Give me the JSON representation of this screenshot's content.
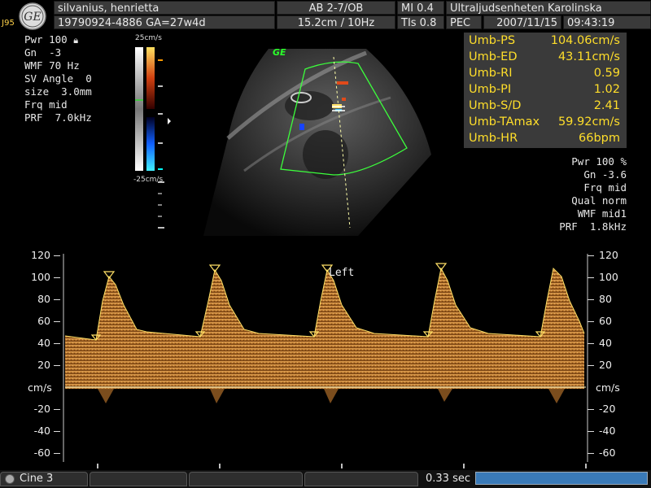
{
  "header": {
    "patient_name": "silvanius, henrietta",
    "patient_id_ga": "19790924-4886  GA=27w4d",
    "probe_preset": "AB 2-7/OB",
    "depth_rate": "15.2cm / 10Hz",
    "mi": "MI  0.4",
    "tis": "TIs  0.8",
    "pec": "PEC",
    "institution": "Ultraljudsenheten Karolinska",
    "date": "2007/11/15",
    "time": "09:43:19",
    "site_label": "J95"
  },
  "left_params": [
    "Pwr 100",
    "Gn  -3",
    "WMF 70 Hz",
    "SV Angle  0",
    "size  3.0mm",
    "Frq mid",
    "PRF  7.0kHz"
  ],
  "colorbar": {
    "top_label": "25cm/s",
    "bottom_label": "-25cm/s"
  },
  "image": {
    "logo_text": "GE"
  },
  "measurements": [
    {
      "label": "Umb-PS",
      "value": "104.06cm/s"
    },
    {
      "label": "Umb-ED",
      "value": "43.11cm/s"
    },
    {
      "label": "Umb-RI",
      "value": "0.59"
    },
    {
      "label": "Umb-PI",
      "value": "1.02"
    },
    {
      "label": "Umb-S/D",
      "value": "2.41"
    },
    {
      "label": "Umb-TAmax",
      "value": "59.92cm/s"
    },
    {
      "label": "Umb-HR",
      "value": "66bpm"
    }
  ],
  "right_params": [
    "Pwr 100 %",
    "Gn -3.6",
    "Frq mid",
    "Qual norm",
    "WMF mid1",
    "PRF  1.8kHz"
  ],
  "spectral": {
    "annotation": "Left",
    "unit": "cm/s",
    "scale_ticks": [
      120,
      100,
      80,
      60,
      40,
      20,
      -20,
      -40,
      -60
    ]
  },
  "footer": {
    "cine_label": "Cine 3",
    "sweep_label": "0.33 sec"
  },
  "colors": {
    "accent_yellow": "#ffde2a",
    "box_gray": "#3a3a3a",
    "doppler_orange": "#c8862e",
    "sector_green": "#3cff3c"
  }
}
